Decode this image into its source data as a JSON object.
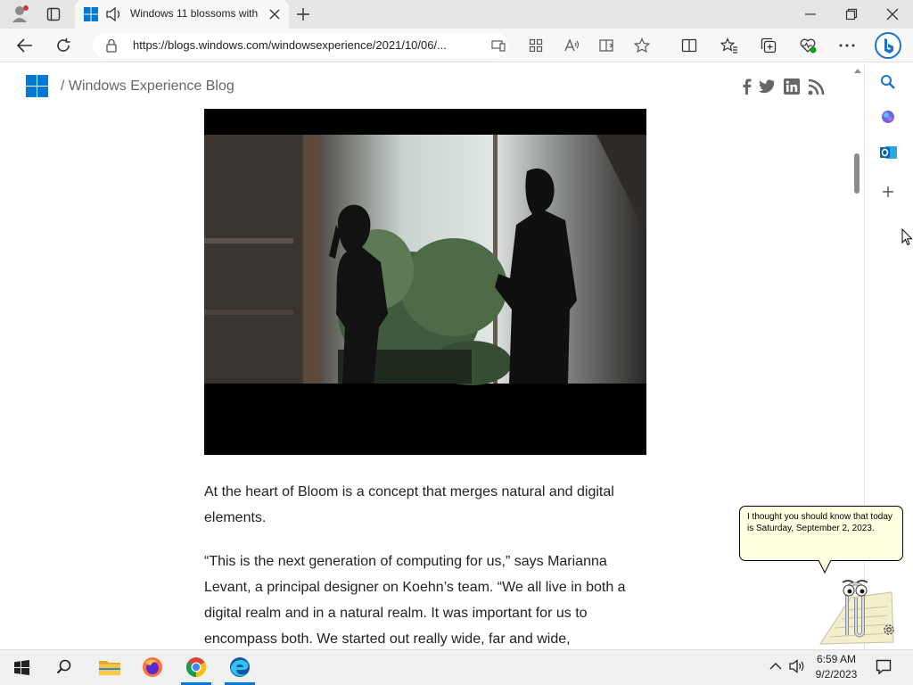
{
  "browser": {
    "tab_title": "Windows 11 blossoms with",
    "url": "https://blogs.windows.com/windowsexperience/2021/10/06/..."
  },
  "site": {
    "blog_title": "/ Windows Experience Blog"
  },
  "article": {
    "paragraph_1": "At the heart of Bloom is a concept that merges natural and digital elements.",
    "paragraph_2": "“This is the next generation of computing for us,” says Marianna Levant, a principal designer on Koehn’s team. “We all live in both a digital realm and in a natural realm. It was important for us to encompass both. We started out really wide, far and wide,"
  },
  "clippy": {
    "message": "I thought you should know that today is Saturday, September 2, 2023."
  },
  "taskbar": {
    "time": "6:59 AM",
    "date": "9/2/2023"
  }
}
